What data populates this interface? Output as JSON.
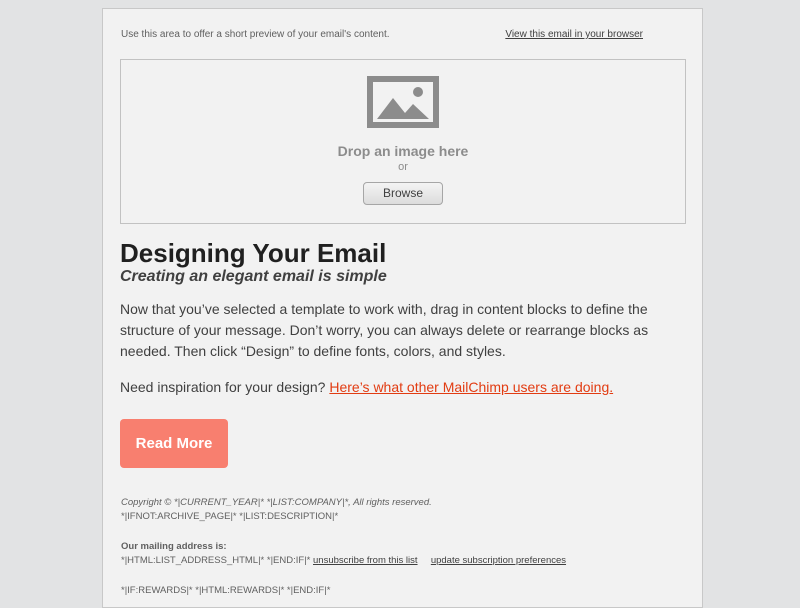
{
  "preheader": {
    "text": "Use this area to offer a short preview of your email's content.",
    "browser_link": "View this email in your browser"
  },
  "image_drop": {
    "icon": "image-placeholder-icon",
    "title": "Drop an image here",
    "or": "or",
    "browse_label": "Browse"
  },
  "content": {
    "title": "Designing Your Email",
    "subtitle": "Creating an elegant email is simple",
    "paragraph": "Now that you’ve selected a template to work with, drag in content blocks to define the structure of your message. Don’t worry, you can always delete or rearrange blocks as needed. Then click “Design” to define fonts, colors, and styles.",
    "inspire_text": "Need inspiration for your design?",
    "inspire_link": "Here’s what other MailChimp users are doing."
  },
  "button": {
    "label": "Read More",
    "color": "#f87f6f"
  },
  "footer": {
    "copyright": "Copyright © *|CURRENT_YEAR|* *|LIST:COMPANY|*, All rights reserved.",
    "description": "*|IFNOT:ARCHIVE_PAGE|* *|LIST:DESCRIPTION|*",
    "address_label": "Our mailing address is:",
    "address_tags": "*|HTML:LIST_ADDRESS_HTML|* *|END:IF|*",
    "unsubscribe": "unsubscribe from this list",
    "update_prefs": "update subscription preferences",
    "rewards": "*|IF:REWARDS|* *|HTML:REWARDS|* *|END:IF|*"
  },
  "colors": {
    "background": "#e2e3e4",
    "card": "#f2f2f2",
    "link": "#e23c12"
  }
}
